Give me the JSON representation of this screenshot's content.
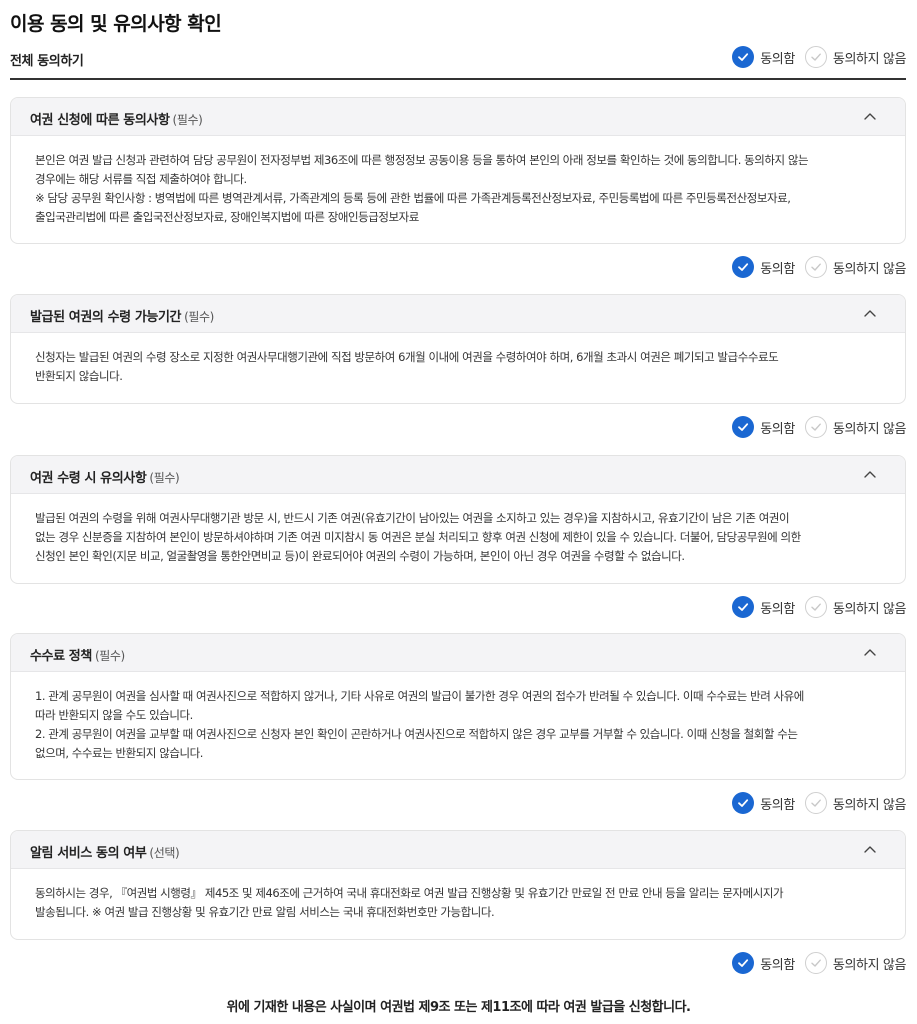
{
  "page": {
    "title": "이용 동의 및 유의사항 확인"
  },
  "all_agree": {
    "label": "전체 동의하기",
    "agree_label": "동의함",
    "disagree_label": "동의하지 않음",
    "selected": "agree"
  },
  "sections": [
    {
      "title": "여권 신청에 따른 동의사항",
      "tag": "(필수)",
      "body": "본인은 여권 발급 신청과 관련하여 담당 공무원이 전자정부법 제36조에 따른 행정정보 공동이용 등을 통하여 본인의 아래 정보를 확인하는 것에 동의합니다. 동의하지 않는\n경우에는 해당 서류를 직접 제출하여야 합니다.\n※ 담당 공무원 확인사항 : 병역법에 따른 병역관계서류, 가족관계의 등록 등에 관한 법률에 따른 가족관계등록전산정보자료, 주민등록법에 따른 주민등록전산정보자료,\n출입국관리법에 따른 출입국전산정보자료, 장애인복지법에 따른 장애인등급정보자료",
      "agree_label": "동의함",
      "disagree_label": "동의하지 않음"
    },
    {
      "title": "발급된 여권의 수령 가능기간",
      "tag": "(필수)",
      "body": "신청자는 발급된 여권의 수령 장소로 지정한 여권사무대행기관에 직접 방문하여 6개월 이내에 여권을 수령하여야 하며, 6개월 초과시 여권은 폐기되고 발급수수료도\n반환되지 않습니다.",
      "agree_label": "동의함",
      "disagree_label": "동의하지 않음"
    },
    {
      "title": "여권 수령 시 유의사항",
      "tag": "(필수)",
      "body": "발급된 여권의 수령을 위해 여권사무대행기관 방문 시, 반드시 기존 여권(유효기간이 남아있는 여권을 소지하고 있는 경우)을 지참하시고, 유효기간이 남은 기존 여권이\n없는 경우 신분증을 지참하여 본인이 방문하셔야하며 기존 여권 미지참시 동 여권은 분실 처리되고 향후 여권 신청에 제한이 있을 수 있습니다. 더불어, 담당공무원에 의한\n신청인 본인 확인(지문 비교, 얼굴촬영을 통한안면비교 등)이 완료되어야 여권의 수령이 가능하며, 본인이 아닌 경우 여권을 수령할 수 없습니다.",
      "agree_label": "동의함",
      "disagree_label": "동의하지 않음"
    },
    {
      "title": "수수료 정책",
      "tag": "(필수)",
      "body": "1. 관계 공무원이 여권을 심사할 때 여권사진으로 적합하지 않거나, 기타 사유로 여권의 발급이 불가한 경우 여권의 접수가 반려될 수 있습니다. 이때 수수료는 반려 사유에\n따라 반환되지 않을 수도 있습니다.\n2. 관계 공무원이 여권을 교부할 때 여권사진으로 신청자 본인 확인이 곤란하거나 여권사진으로 적합하지 않은 경우 교부를 거부할 수 있습니다. 이때 신청을 철회할 수는\n없으며, 수수료는 반환되지 않습니다.",
      "agree_label": "동의함",
      "disagree_label": "동의하지 않음"
    },
    {
      "title": "알림 서비스 동의 여부",
      "tag": "(선택)",
      "body": "동의하시는 경우, 『여권법 시행령』 제45조 및 제46조에 근거하여 국내 휴대전화로 여권 발급 진행상황 및 유효기간 만료일 전 만료 안내 등을 알리는 문자메시지가\n발송됩니다. ※ 여권 발급 진행상황 및 유효기간 만료 알림 서비스는 국내 휴대전화번호만 가능합니다.",
      "agree_label": "동의함",
      "disagree_label": "동의하지 않음"
    }
  ],
  "footer": {
    "statement": "위에 기재한 내용은 사실이며 여권법 제9조 또는 제11조에 따라 여권 발급을 신청합니다."
  },
  "colors": {
    "accent": "#1a67d2",
    "header_bg": "#f4f4f6",
    "border": "#e3e3e3"
  },
  "icons": {
    "checked": "check-icon",
    "unchecked": "check-outline-icon",
    "collapse": "chevron-up-icon"
  }
}
